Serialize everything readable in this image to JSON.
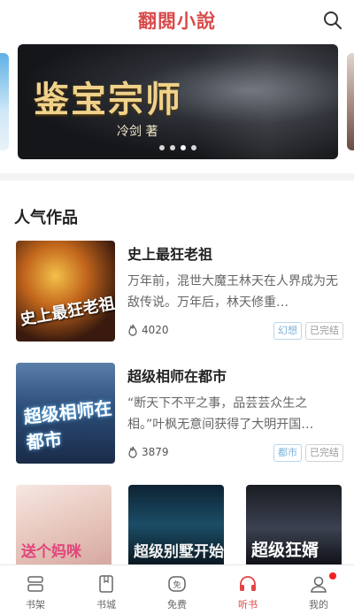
{
  "app": {
    "title": "翻閱小說"
  },
  "banner": {
    "title": "鉴宝宗师",
    "author": "冷剑 著",
    "slides": 4,
    "active_slide": 2
  },
  "section": {
    "title": "人气作品"
  },
  "books": [
    {
      "title": "史上最狂老祖",
      "description": "万年前，混世大魔王林天在人界成为无敌传说。万年后，林天修重…",
      "heat": "4020",
      "genre": "幻想",
      "status": "已完结",
      "cover_text": "史上最狂老祖"
    },
    {
      "title": "超级相师在都市",
      "description": "“断天下不平之事，品芸芸众生之相。”叶枫无意间获得了大明开国…",
      "heat": "3879",
      "genre": "都市",
      "status": "已完结",
      "cover_text": "超级相师在都市"
    }
  ],
  "more_covers": [
    {
      "cover_text": "送个妈咪"
    },
    {
      "cover_text": "超级别墅开始"
    },
    {
      "cover_text": "超级狂婿"
    }
  ],
  "tabs": [
    {
      "label": "书架",
      "icon": "bookshelf-icon"
    },
    {
      "label": "书城",
      "icon": "bookstore-icon"
    },
    {
      "label": "免费",
      "icon": "free-icon"
    },
    {
      "label": "听书",
      "icon": "headphones-icon"
    },
    {
      "label": "我的",
      "icon": "user-icon"
    }
  ],
  "colors": {
    "accent": "#e04545",
    "brand": "#d94b4b",
    "genre_tag": "#7ab0d8"
  }
}
